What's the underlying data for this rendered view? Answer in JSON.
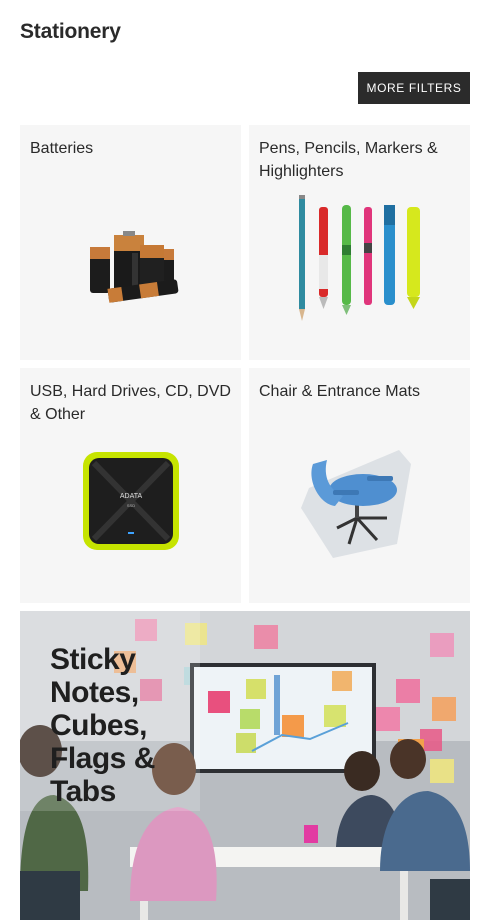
{
  "page": {
    "title": "Stationery"
  },
  "filters": {
    "label": "MORE FILTERS"
  },
  "categories": [
    {
      "label": "Batteries",
      "image_icon": "batteries-icon"
    },
    {
      "label": "Pens, Pencils, Markers & Highlighters",
      "image_icon": "pens-icon"
    },
    {
      "label": "USB, Hard Drives, CD, DVD & Other",
      "image_icon": "hard-drive-icon"
    },
    {
      "label": "Chair & Entrance Mats",
      "image_icon": "chair-mat-icon"
    }
  ],
  "banner": {
    "title": "Sticky Notes, Cubes, Flags & Tabs"
  },
  "colors": {
    "button_bg": "#2b2b2b",
    "card_bg": "#f6f6f6",
    "drive_accent": "#c6e400",
    "chair_blue": "#4f8fd0"
  }
}
